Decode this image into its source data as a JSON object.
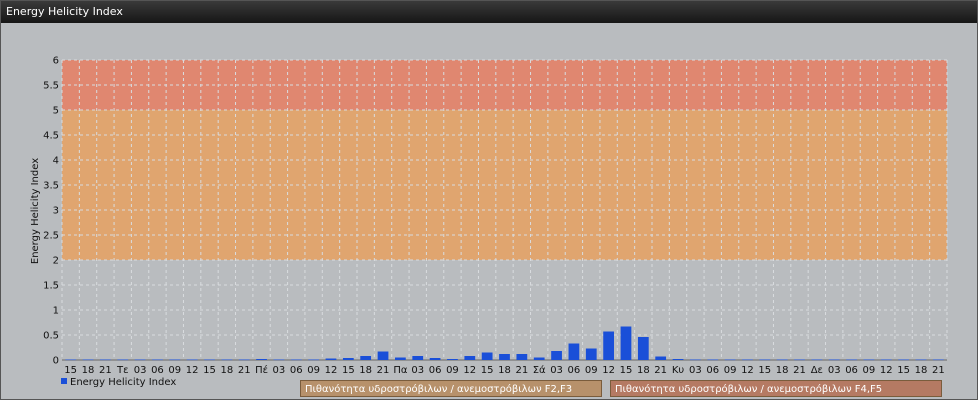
{
  "window": {
    "title": "Energy Helicity Index"
  },
  "legend": {
    "series_label": "Energy Helicity Index"
  },
  "bands": [
    {
      "label": "Πιθανότητα υδροστρόβιλων / ανεμοστρόβιλων F2,F3",
      "from": 2,
      "to": 5,
      "color": "#e0a56f"
    },
    {
      "label": "Πιθανότητα υδροστρόβιλων / ανεμοστρόβιλων F4,F5",
      "from": 5,
      "to": 6,
      "color": "#e08770"
    }
  ],
  "colors": {
    "bar": "#1a4fd8",
    "plot_bg": "#b9bcbf",
    "grid": "#d9dcdf"
  },
  "chart_data": {
    "type": "bar",
    "title": "Energy Helicity Index",
    "ylabel": "Energy Helicity Index",
    "xlabel": "",
    "ylim": [
      0,
      6
    ],
    "yticks": [
      "0",
      "0.5",
      "1",
      "1.5",
      "2",
      "2.5",
      "3",
      "3.5",
      "4",
      "4.5",
      "5",
      "5.5",
      "6"
    ],
    "categories": [
      "15",
      "18",
      "21",
      "Τε",
      "03",
      "06",
      "09",
      "12",
      "15",
      "18",
      "21",
      "Πέ",
      "03",
      "06",
      "09",
      "12",
      "15",
      "18",
      "21",
      "Πα",
      "03",
      "06",
      "09",
      "12",
      "15",
      "18",
      "21",
      "Σά",
      "03",
      "06",
      "09",
      "12",
      "15",
      "18",
      "21",
      "Κυ",
      "03",
      "06",
      "09",
      "12",
      "15",
      "18",
      "21",
      "Δε",
      "03",
      "06",
      "09",
      "12",
      "15",
      "18",
      "21"
    ],
    "series": [
      {
        "name": "Energy Helicity Index",
        "values": [
          0.01,
          0.01,
          0.01,
          0.01,
          0.01,
          0.01,
          0.01,
          0.01,
          0.01,
          0.01,
          0.01,
          0.02,
          0.01,
          0.01,
          0.01,
          0.03,
          0.04,
          0.08,
          0.17,
          0.05,
          0.08,
          0.04,
          0.02,
          0.08,
          0.15,
          0.12,
          0.12,
          0.05,
          0.18,
          0.33,
          0.23,
          0.57,
          0.67,
          0.46,
          0.07,
          0.02,
          0.01,
          0.01,
          0.01,
          0.01,
          0.01,
          0.01,
          0.01,
          0.01,
          0.01,
          0.01,
          0.01,
          0.01,
          0.01,
          0.01,
          0.01
        ]
      }
    ]
  }
}
